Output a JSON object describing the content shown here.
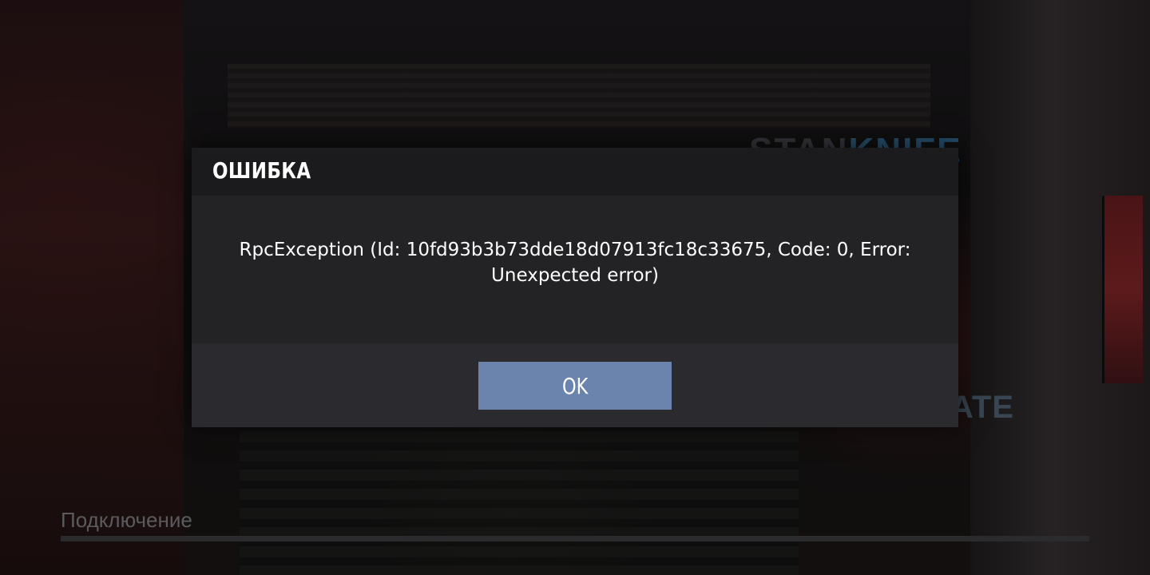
{
  "background": {
    "logo": {
      "part1": "STAN",
      "part2": "KNIFE"
    },
    "menu_fragment": "ATE"
  },
  "loading": {
    "status_label": "Подключение",
    "progress": 0.0
  },
  "dialog": {
    "title": "ОШИБКА",
    "message": "RpcException (Id: 10fd93b3b73dde18d07913fc18c33675, Code: 0, Error: Unexpected error)",
    "ok_button_label": "OK"
  },
  "colors": {
    "dialog_header": "#1b1b1d",
    "dialog_body": "#232326",
    "dialog_footer": "#2b2b2f",
    "ok_button": "#6b84ad",
    "text": "#ffffff"
  }
}
